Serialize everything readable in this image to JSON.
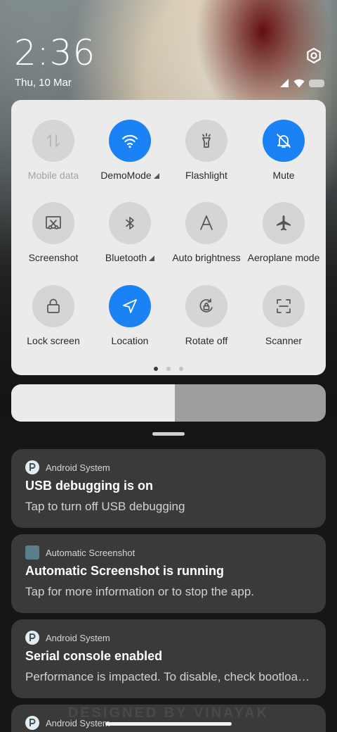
{
  "header": {
    "time": "2:36",
    "date": "Thu, 10 Mar"
  },
  "icons": {
    "settings": "settings-gear-icon",
    "signal": "cell-signal-icon",
    "wifi": "wifi-icon",
    "battery": "battery-icon"
  },
  "colors": {
    "accent": "#1a82f5",
    "tile_off": "#d5d5d5",
    "panel": "#ebebeb",
    "notification_bg": "#3a3a3a"
  },
  "quick_settings": {
    "tiles": [
      {
        "label": "Mobile data",
        "icon": "mobile-data-icon",
        "state": "disabled"
      },
      {
        "label": "DemoMode",
        "icon": "wifi-icon",
        "state": "on",
        "expandable": true
      },
      {
        "label": "Flashlight",
        "icon": "flashlight-icon",
        "state": "off"
      },
      {
        "label": "Mute",
        "icon": "bell-off-icon",
        "state": "on"
      },
      {
        "label": "Screenshot",
        "icon": "screenshot-icon",
        "state": "off"
      },
      {
        "label": "Bluetooth",
        "icon": "bluetooth-icon",
        "state": "off",
        "expandable": true
      },
      {
        "label": "Auto brightness",
        "icon": "auto-brightness-icon",
        "state": "off"
      },
      {
        "label": "Aeroplane mode",
        "icon": "airplane-icon",
        "state": "off"
      },
      {
        "label": "Lock screen",
        "icon": "lock-icon",
        "state": "off"
      },
      {
        "label": "Location",
        "icon": "location-arrow-icon",
        "state": "on"
      },
      {
        "label": "Rotate off",
        "icon": "rotate-lock-icon",
        "state": "off"
      },
      {
        "label": "Scanner",
        "icon": "scanner-icon",
        "state": "off"
      }
    ],
    "pages": 3,
    "current_page": 1
  },
  "brightness": {
    "level": 0.52
  },
  "notifications": [
    {
      "app": "Android System",
      "title": "USB debugging is on",
      "text": "Tap to turn off USB debugging",
      "icon": "android-system-icon"
    },
    {
      "app": "Automatic Screenshot",
      "title": "Automatic Screenshot is running",
      "text": "Tap for more information or to stop the app.",
      "icon": "app-square-icon"
    },
    {
      "app": "Android System",
      "title": "Serial console enabled",
      "text": "Performance is impacted. To disable, check bootloader.",
      "icon": "android-system-icon"
    },
    {
      "app": "Android System",
      "title": "",
      "text": "",
      "icon": "android-system-icon"
    }
  ],
  "watermark": "DESIGNED BY VINAYAK"
}
